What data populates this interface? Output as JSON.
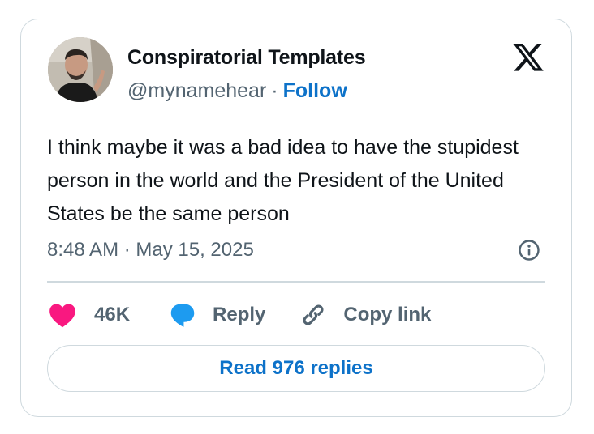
{
  "author": {
    "display_name": "Conspiratorial Templates",
    "handle": "@mynamehear",
    "separator": "·",
    "follow_label": "Follow"
  },
  "tweet": {
    "text": "I think maybe it was a bad idea to have the stupidest person in the world and the President of the United States be the same person",
    "timestamp": "8:48 AM · May 15, 2025"
  },
  "actions": {
    "like_count": "46K",
    "reply_label": "Reply",
    "copy_link_label": "Copy link"
  },
  "read_replies_label": "Read 976 replies",
  "icons": {
    "brand": "x-logo-icon",
    "info": "info-icon",
    "like": "heart-icon",
    "reply": "speech-bubble-icon",
    "copy": "link-icon"
  },
  "colors": {
    "link_blue": "#0d72c9",
    "heart_pink": "#f91880",
    "reply_blue": "#1d9bf0",
    "muted_text": "#536471",
    "border": "#cfd9de"
  }
}
